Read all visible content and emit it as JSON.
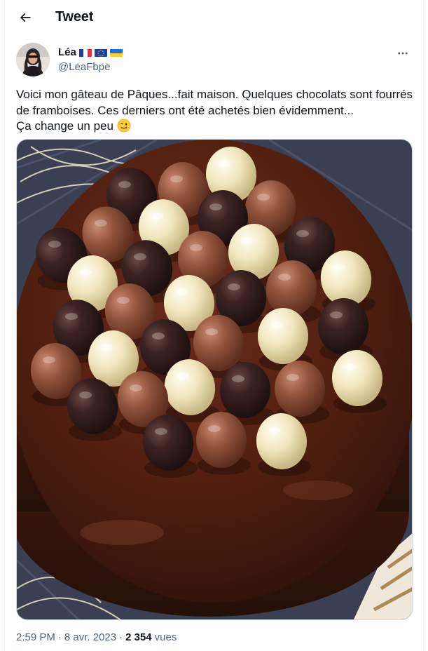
{
  "header": {
    "title": "Tweet",
    "back_icon": "arrow-left-icon"
  },
  "author": {
    "name": "Léa",
    "handle": "@LeaFbpe",
    "flags": [
      "france-flag-icon",
      "eu-flag-icon",
      "ukraine-flag-icon"
    ]
  },
  "tweet": {
    "text": "Voici mon gâteau de Pâques...fait maison. Quelques chocolats sont fourrés de framboises. Ces derniers ont été achetés bien évidemment...\nÇa change un peu",
    "emoji": "winking-face-emoji",
    "image_alt": "Chocolate glazed cake topped with chocolate eggs"
  },
  "meta": {
    "time": "2:59 PM",
    "separator": "·",
    "date": "8 avr. 2023",
    "views_count": "2 354",
    "views_label": "vues"
  },
  "colors": {
    "text_primary": "#0f1419",
    "text_secondary": "#536471",
    "border": "#cfd9de",
    "chocolate_glaze": "#4a1c12"
  }
}
